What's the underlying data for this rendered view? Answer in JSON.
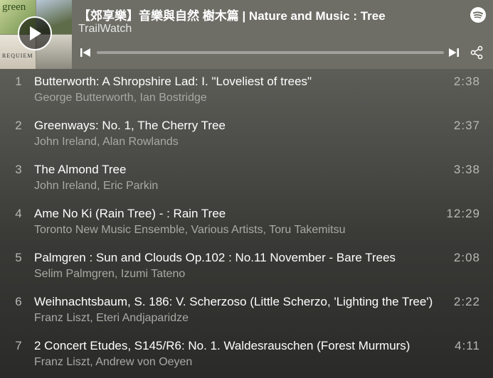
{
  "playlist": {
    "title": "【郊享樂】音樂與自然 樹木篇 | Nature and Music : Tree",
    "owner": "TrailWatch"
  },
  "cover": {
    "text_top_left": "green",
    "text_bottom_left": "REQUIEM"
  },
  "controls": {
    "play_icon": "play-icon",
    "prev_icon": "skip-previous-icon",
    "next_icon": "skip-next-icon",
    "share_icon": "share-icon",
    "brand_icon": "spotify-icon"
  },
  "tracks": [
    {
      "num": "1",
      "title": "Butterworth: A Shropshire Lad: I. \"Loveliest of trees\"",
      "artists": "George Butterworth, Ian Bostridge",
      "duration": "2:38"
    },
    {
      "num": "2",
      "title": "Greenways: No. 1, The Cherry Tree",
      "artists": "John Ireland, Alan Rowlands",
      "duration": "2:37"
    },
    {
      "num": "3",
      "title": "The Almond Tree",
      "artists": "John Ireland, Eric Parkin",
      "duration": "3:38"
    },
    {
      "num": "4",
      "title": "Ame No Ki (Rain Tree) - : Rain Tree",
      "artists": "Toronto New Music Ensemble, Various Artists, Toru Takemitsu",
      "duration": "12:29"
    },
    {
      "num": "5",
      "title": "Palmgren : Sun and Clouds Op.102 : No.11 November - Bare Trees",
      "artists": "Selim Palmgren, Izumi Tateno",
      "duration": "2:08"
    },
    {
      "num": "6",
      "title": "Weihnachtsbaum, S. 186: V. Scherzoso (Little Scherzo, 'Lighting the Tree')",
      "artists": "Franz Liszt, Eteri Andjaparidze",
      "duration": "2:22"
    },
    {
      "num": "7",
      "title": "2 Concert Etudes, S145/R6: No. 1. Waldesrauschen (Forest Murmurs)",
      "artists": "Franz Liszt, Andrew von Oeyen",
      "duration": "4:11"
    }
  ]
}
